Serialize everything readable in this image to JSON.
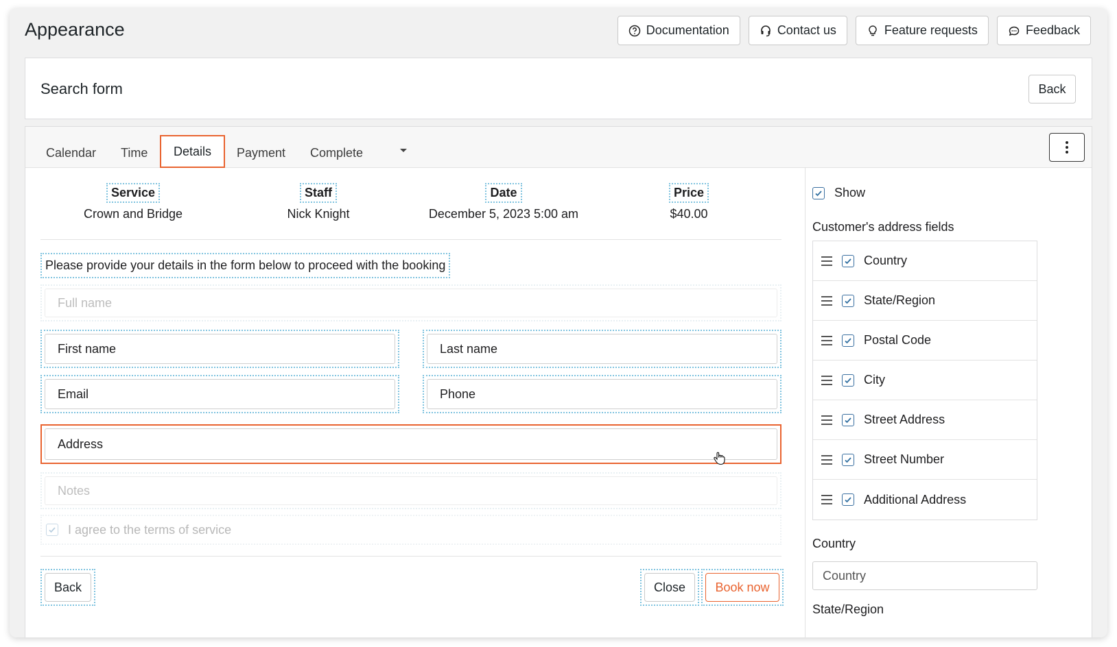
{
  "header": {
    "title": "Appearance",
    "buttons": {
      "documentation": "Documentation",
      "contact": "Contact us",
      "feature": "Feature requests",
      "feedback": "Feedback"
    }
  },
  "top_panel": {
    "title": "Search form",
    "back_label": "Back"
  },
  "tabs": [
    "Calendar",
    "Time",
    "Details",
    "Payment",
    "Complete"
  ],
  "active_tab": "Details",
  "summary": {
    "service": {
      "label": "Service",
      "value": "Crown and Bridge"
    },
    "staff": {
      "label": "Staff",
      "value": "Nick Knight"
    },
    "date": {
      "label": "Date",
      "value": "December 5, 2023 5:00 am"
    },
    "price": {
      "label": "Price",
      "value": "$40.00"
    }
  },
  "form": {
    "intro": "Please provide your details in the form below to proceed with the booking",
    "full_name": "Full name",
    "first_name": "First name",
    "last_name": "Last name",
    "email": "Email",
    "phone": "Phone",
    "address": "Address",
    "notes": "Notes",
    "terms": "I agree to the terms of service",
    "back": "Back",
    "close": "Close",
    "book_now": "Book now"
  },
  "sidebar": {
    "show_label": "Show",
    "address_fields_title": "Customer's address fields",
    "address_fields": [
      "Country",
      "State/Region",
      "Postal Code",
      "City",
      "Street Address",
      "Street Number",
      "Additional Address"
    ],
    "country_label": "Country",
    "country_placeholder": "Country",
    "state_label": "State/Region"
  },
  "colors": {
    "accent": "#e9632f",
    "dotted_outline": "#7fc3df"
  }
}
